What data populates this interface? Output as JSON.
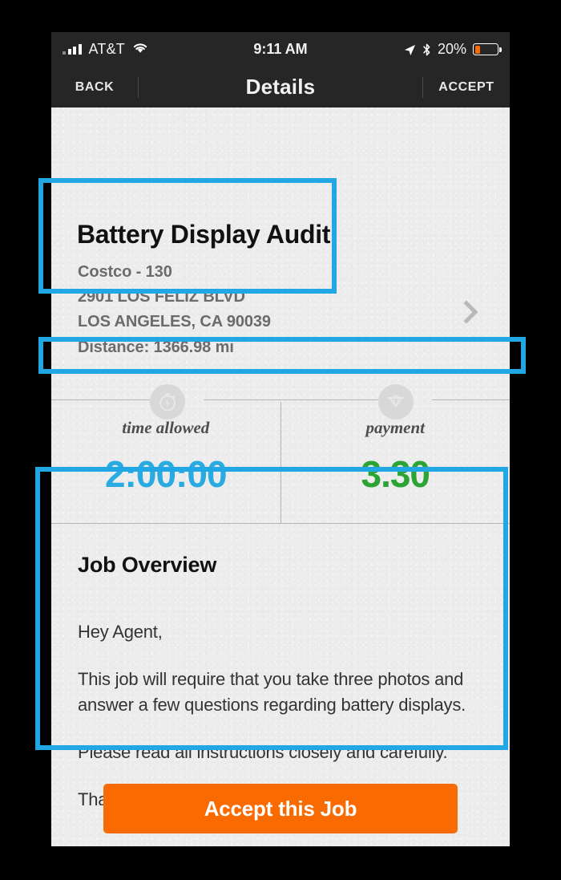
{
  "status_bar": {
    "carrier": "AT&T",
    "wifi_icon": "wifi-icon",
    "time": "9:11 AM",
    "location_icon": "location-arrow-icon",
    "bluetooth_icon": "bluetooth-icon",
    "battery_percent": "20%",
    "battery_level": 20,
    "battery_color": "#f96a00"
  },
  "nav": {
    "back_label": "BACK",
    "title": "Details",
    "accept_label": "ACCEPT"
  },
  "job": {
    "title": "Battery Display Audit",
    "location_name": "Costco - 130",
    "address_line1": "2901 LOS FELIZ BLVD",
    "address_line2": "LOS ANGELES, CA 90039",
    "distance": "Distance: 1366.98 mi",
    "disclosure_icon": "chevron-right-icon"
  },
  "stats": {
    "time": {
      "icon": "stopwatch-icon",
      "label": "time allowed",
      "value": "2:00:00",
      "color": "#29abe2"
    },
    "payment": {
      "icon": "diamond-icon",
      "label": "payment",
      "value": "3.30",
      "color": "#2ca335"
    }
  },
  "overview": {
    "heading": "Job Overview",
    "paragraphs": [
      "Hey Agent,",
      "This job will require that you take three photos and answer a few questions regarding battery displays.",
      "Please read all instructions closely and carefully.",
      "Thank you!"
    ]
  },
  "cta": {
    "label": "Accept this Job",
    "color": "#f96a00"
  },
  "annotations": {
    "highlight_color": "#22a7e5",
    "boxes": [
      {
        "name": "address-block",
        "target": "job.location_name"
      },
      {
        "name": "stat-labels-row",
        "target": "stats"
      },
      {
        "name": "job-overview-block",
        "target": "overview"
      }
    ]
  }
}
